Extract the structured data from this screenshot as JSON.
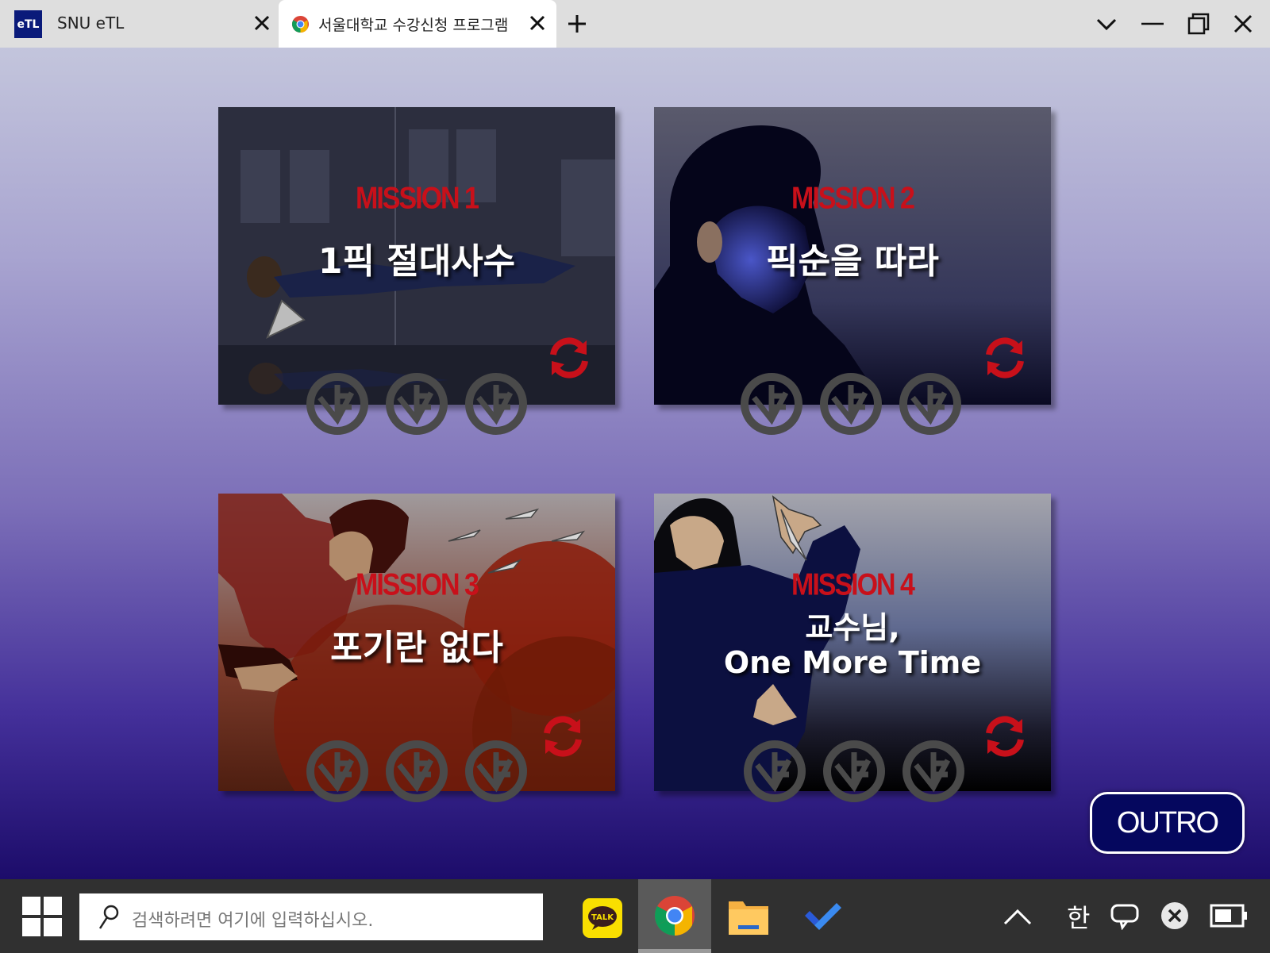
{
  "browser": {
    "tabs": [
      {
        "title": "SNU eTL",
        "favicon_text": "eTL"
      },
      {
        "title": "서울대학교 수강신청 프로그램",
        "favicon": "chrome-icon"
      }
    ],
    "window_controls": [
      "chevron-down-icon",
      "minimize-icon",
      "restore-icon",
      "close-icon"
    ]
  },
  "missions": [
    {
      "label": "MISSION 1",
      "title": "1픽 절대사수"
    },
    {
      "label": "MISSION 2",
      "title": "픽순을 따라"
    },
    {
      "label": "MISSION 3",
      "title": "포기란 없다"
    },
    {
      "label": "MISSION 4",
      "title": "교수님,\nOne More Time"
    }
  ],
  "outro_label": "OUTRO",
  "taskbar": {
    "search_placeholder": "검색하려면 여기에 입력하십시오.",
    "apps": [
      "kakaotalk-icon",
      "chrome-icon",
      "file-explorer-icon",
      "todo-icon"
    ],
    "kakaotalk_text": "TALK",
    "ime_label": "한"
  },
  "colors": {
    "mission_label": "#c8101a",
    "outro_bg": "#05075e",
    "taskbar": "#303030"
  }
}
